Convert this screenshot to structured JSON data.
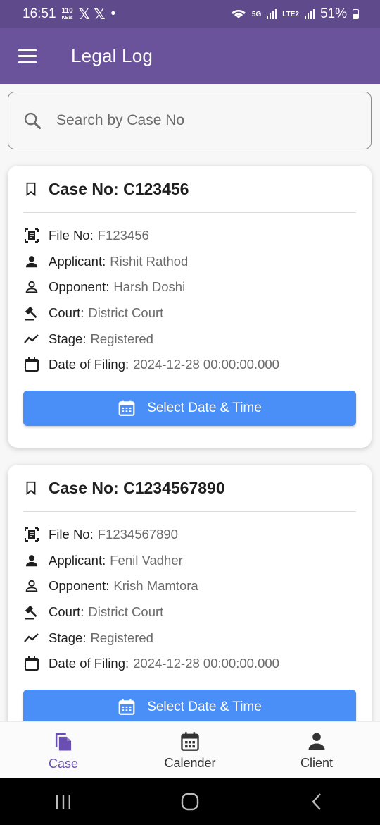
{
  "status_bar": {
    "time": "16:51",
    "speed_top": "110",
    "speed_bottom": "KB/s",
    "x_icons": "𝕏 𝕏",
    "dot": "•",
    "battery": "51%",
    "net1": "5G",
    "net2": "LTE2"
  },
  "app_bar": {
    "title": "Legal Log",
    "menu_icon": "hamburger-icon"
  },
  "search": {
    "placeholder": "Search by Case No",
    "value": ""
  },
  "cases": [
    {
      "title": "Case No: C123456",
      "fields": {
        "file_label": "File No:",
        "file_value": "F123456",
        "applicant_label": "Applicant:",
        "applicant_value": "Rishit Rathod",
        "opponent_label": "Opponent:",
        "opponent_value": "Harsh Doshi",
        "court_label": "Court:",
        "court_value": "District Court",
        "stage_label": "Stage:",
        "stage_value": "Registered",
        "date_label": "Date of Filing:",
        "date_value": "2024-12-28 00:00:00.000"
      },
      "button": "Select Date & Time"
    },
    {
      "title": "Case No: C1234567890",
      "fields": {
        "file_label": "File No:",
        "file_value": "F1234567890",
        "applicant_label": "Applicant:",
        "applicant_value": "Fenil Vadher",
        "opponent_label": "Opponent:",
        "opponent_value": "Krish Mamtora",
        "court_label": "Court:",
        "court_value": "District Court",
        "stage_label": "Stage:",
        "stage_value": "Registered",
        "date_label": "Date of Filing:",
        "date_value": "2024-12-28 00:00:00.000"
      },
      "button": "Select Date & Time"
    }
  ],
  "bottom_nav": [
    {
      "label": "Case",
      "icon": "files-icon",
      "active": true
    },
    {
      "label": "Calender",
      "icon": "calendar-icon",
      "active": false
    },
    {
      "label": "Client",
      "icon": "person-icon",
      "active": false
    }
  ],
  "colors": {
    "app_bar": "#6a539b",
    "status_bar": "#5f4a8b",
    "primary_button": "#4a8ef7",
    "active_nav": "#6a4fb0"
  }
}
